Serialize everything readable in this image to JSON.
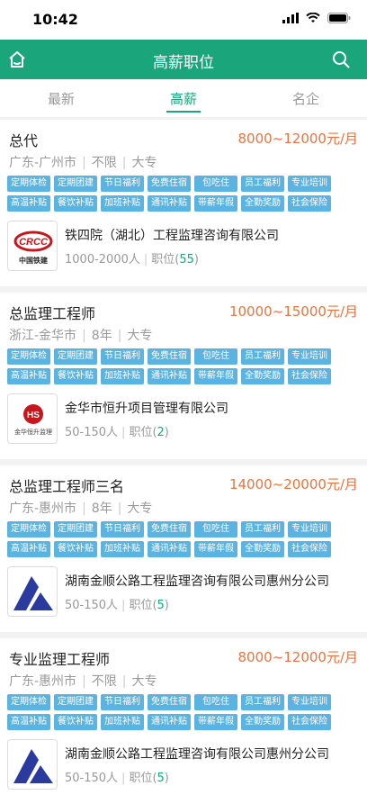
{
  "status": {
    "time": "10:42"
  },
  "nav": {
    "title": "高薪职位"
  },
  "tabs": [
    {
      "label": "最新"
    },
    {
      "label": "高薪"
    },
    {
      "label": "名企"
    }
  ],
  "tags": [
    "定期体检",
    "定期团建",
    "节日福利",
    "免费住宿",
    "包吃住",
    "员工福利",
    "专业培训",
    "高温补贴",
    "餐饮补贴",
    "加班补贴",
    "通讯补贴",
    "带薪年假",
    "全勤奖励",
    "社会保险"
  ],
  "jobs": [
    {
      "title": "总代",
      "salary": "8000~12000元/月",
      "location": "广东-广州市",
      "experience": "不限",
      "education": "大专",
      "company": {
        "name": "铁四院（湖北）工程监理咨询有限公司",
        "size": "1000-2000人",
        "positions_label": "职位(",
        "positions_count": "55",
        "positions_end": ")",
        "logo_text": "中国铁建",
        "logo_mark": "CRCC"
      }
    },
    {
      "title": "总监理工程师",
      "salary": "10000~15000元/月",
      "location": "浙江-金华市",
      "experience": "8年",
      "education": "大专",
      "company": {
        "name": "金华市恒升项目管理有限公司",
        "size": "50-150人",
        "positions_label": "职位(",
        "positions_count": "2",
        "positions_end": ")",
        "logo_text": "金华恒升监理",
        "logo_mark": "HS"
      }
    },
    {
      "title": "总监理工程师三名",
      "salary": "14000~20000元/月",
      "location": "广东-惠州市",
      "experience": "8年",
      "education": "大专",
      "company": {
        "name": "湖南金顺公路工程监理咨询有限公司惠州分公司",
        "size": "50-150人",
        "positions_label": "职位(",
        "positions_count": "5",
        "positions_end": ")"
      }
    },
    {
      "title": "专业监理工程师",
      "salary": "8000~12000元/月",
      "location": "广东-惠州市",
      "experience": "不限",
      "education": "大专",
      "company": {
        "name": "湖南金顺公路工程监理咨询有限公司惠州分公司",
        "size": "50-150人",
        "positions_label": "职位(",
        "positions_count": "5",
        "positions_end": ")"
      }
    }
  ],
  "colors": {
    "primary": "#1aa57b",
    "salary": "#e7753f",
    "tag": "#5bb3df"
  }
}
